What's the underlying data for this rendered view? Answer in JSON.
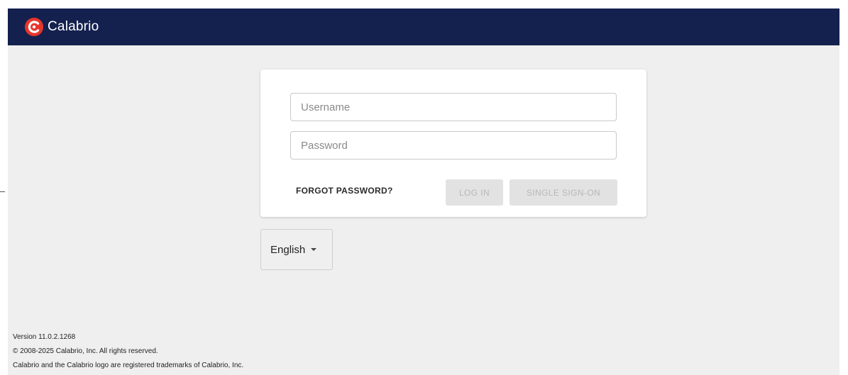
{
  "header": {
    "brand_name": "Calabrio",
    "logo_icon": "calabrio-logo-icon",
    "background_color": "#14214f",
    "logo_color": "#e8352b"
  },
  "login": {
    "username_placeholder": "Username",
    "username_value": "",
    "password_placeholder": "Password",
    "password_value": "",
    "forgot_password_label": "FORGOT PASSWORD?",
    "login_label": "LOG IN",
    "sso_label": "SINGLE SIGN-ON"
  },
  "language": {
    "selected": "English",
    "icon": "caret-down-icon"
  },
  "footer": {
    "version": "Version 11.0.2.1268",
    "copyright": "© 2008-2025 Calabrio, Inc. All rights reserved.",
    "trademark": "Calabrio and the Calabrio logo are registered trademarks of Calabrio, Inc."
  }
}
